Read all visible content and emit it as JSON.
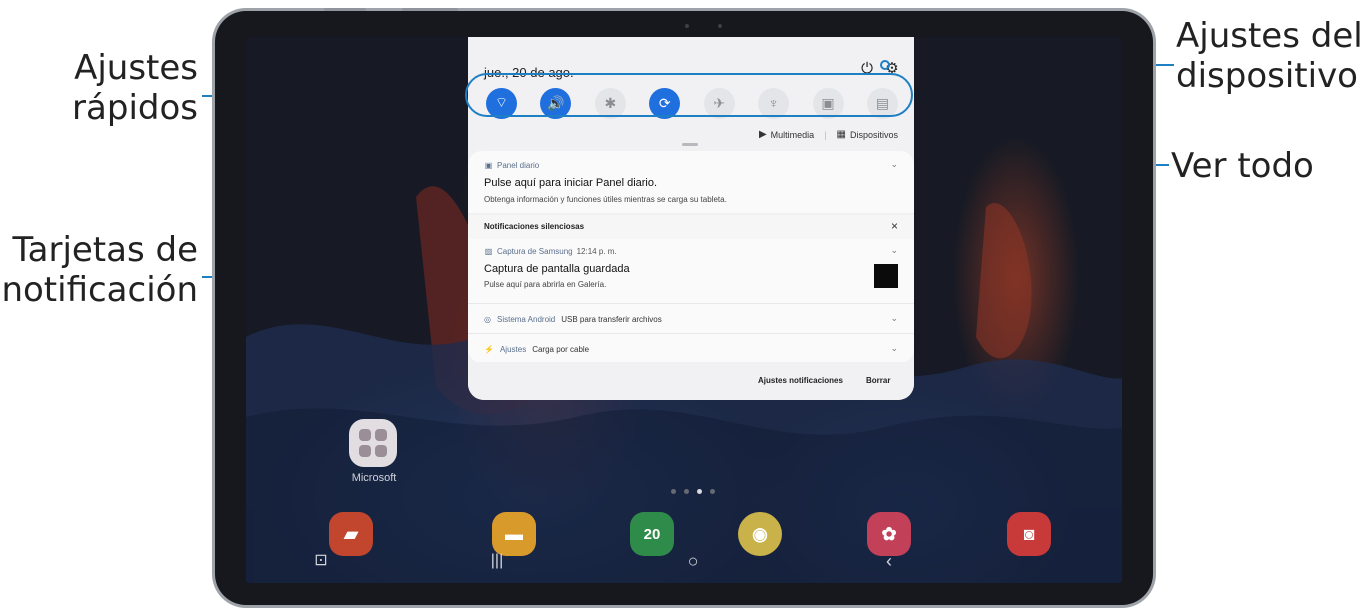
{
  "callouts": {
    "quick_settings": [
      "Ajustes",
      "rápidos"
    ],
    "notification_cards": [
      "Tarjetas de",
      "notificación"
    ],
    "device_settings": [
      "Ajustes del",
      "dispositivo"
    ],
    "view_all": "Ver todo"
  },
  "colors": {
    "callout_line": "#1f7fc4",
    "qs_active": "#1f6fde"
  },
  "panel": {
    "date": "jue., 20 de ago.",
    "power_icon": "power-icon",
    "settings_icon": "gear-icon",
    "quick_settings": [
      {
        "icon": "wifi-icon",
        "glyph": "⌔",
        "state": "on"
      },
      {
        "icon": "sound-icon",
        "glyph": "🔊",
        "state": "on"
      },
      {
        "icon": "bluetooth-icon",
        "glyph": "✱",
        "state": "off"
      },
      {
        "icon": "auto-rotate-icon",
        "glyph": "⟳",
        "state": "on"
      },
      {
        "icon": "airplane-icon",
        "glyph": "✈",
        "state": "off"
      },
      {
        "icon": "flashlight-icon",
        "glyph": "♆",
        "state": "off"
      },
      {
        "icon": "battery-saver-icon",
        "glyph": "▣",
        "state": "off"
      },
      {
        "icon": "secure-folder-icon",
        "glyph": "▤",
        "state": "off"
      }
    ],
    "media_label": "Multimedia",
    "devices_label": "Dispositivos"
  },
  "notifications": {
    "daily": {
      "app": "Panel diario",
      "title": "Pulse aquí para iniciar Panel diario.",
      "text": "Obtenga información y funciones útiles mientras se carga su tableta."
    },
    "silent_header": "Notificaciones silenciosas",
    "capture": {
      "app": "Captura de Samsung",
      "time": "12:14 p. m.",
      "title": "Captura de pantalla guardada",
      "text": "Pulse aquí para abrirla en Galería."
    },
    "android": {
      "app": "Sistema Android",
      "text": "USB para transferir archivos"
    },
    "settings": {
      "app": "Ajustes",
      "text": "Carga por cable"
    },
    "footer": {
      "settings_label": "Ajustes notificaciones",
      "clear_label": "Borrar"
    }
  },
  "home": {
    "folder_label": "Microsoft",
    "calendar_day": "20"
  }
}
